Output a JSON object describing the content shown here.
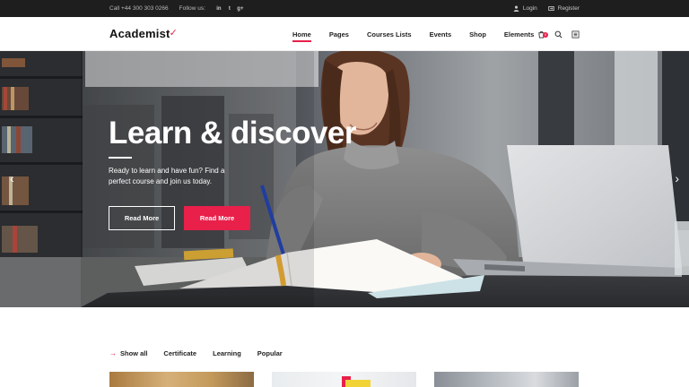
{
  "topbar": {
    "phone": "Call +44 300 303 0266",
    "follow_label": "Follow us:",
    "social": [
      {
        "icon": "linkedin-icon",
        "glyph": "in"
      },
      {
        "icon": "twitter-icon",
        "glyph": "t"
      },
      {
        "icon": "google-plus-icon",
        "glyph": "g+"
      }
    ],
    "login": "Login",
    "register": "Register"
  },
  "header": {
    "logo": "Academist",
    "nav": [
      "Home",
      "Pages",
      "Courses Lists",
      "Events",
      "Shop",
      "Elements"
    ],
    "active_nav": "Home",
    "cart_count": "0",
    "icons": [
      "cart-icon",
      "search-icon",
      "menu-icon"
    ]
  },
  "hero": {
    "title": "Learn & discover",
    "subtitle": "Ready to learn and have fun? Find a perfect course and join us today.",
    "button_outline": "Read More",
    "button_solid": "Read More",
    "prev_glyph": "‹",
    "next_glyph": "›"
  },
  "filters": [
    "Show all",
    "Certificate",
    "Learning",
    "Popular"
  ],
  "colors": {
    "accent": "#e8204a",
    "topbar": "#1e1e1e"
  }
}
